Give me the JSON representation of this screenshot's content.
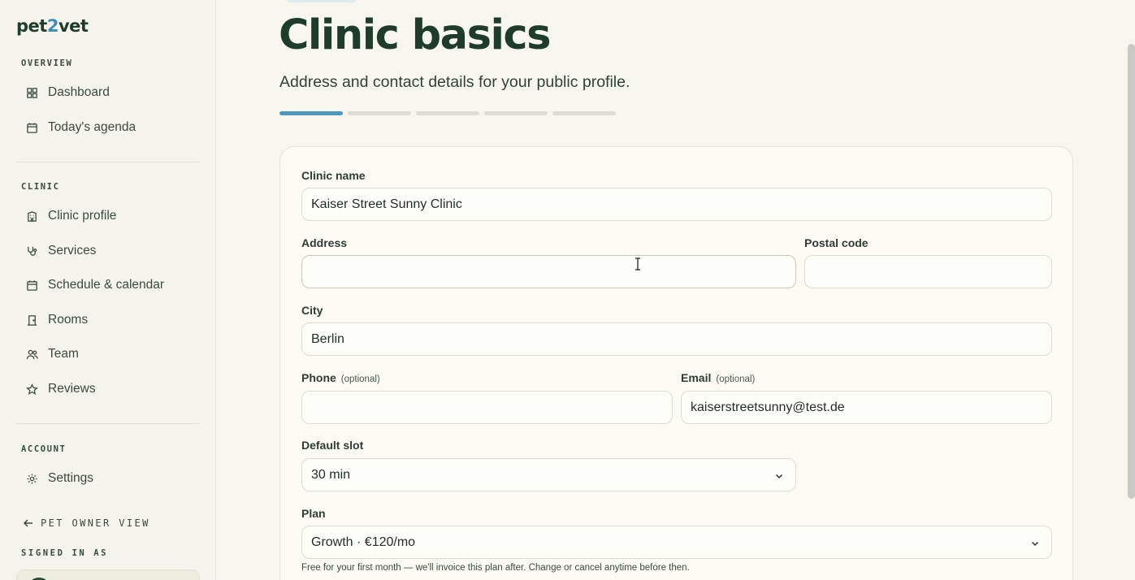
{
  "brand": {
    "prefix": "pet",
    "two": "2",
    "suffix": "vet"
  },
  "sidebar": {
    "overview_label": "OVERVIEW",
    "overview_items": [
      {
        "label": "Dashboard",
        "icon": "grid-icon"
      },
      {
        "label": "Today's agenda",
        "icon": "calendar-icon"
      }
    ],
    "clinic_label": "CLINIC",
    "clinic_items": [
      {
        "label": "Clinic profile",
        "icon": "building-icon"
      },
      {
        "label": "Services",
        "icon": "stethoscope-icon"
      },
      {
        "label": "Schedule & calendar",
        "icon": "calendar-icon"
      },
      {
        "label": "Rooms",
        "icon": "door-icon"
      },
      {
        "label": "Team",
        "icon": "users-icon"
      },
      {
        "label": "Reviews",
        "icon": "star-icon"
      }
    ],
    "account_label": "ACCOUNT",
    "account_items": [
      {
        "label": "Settings",
        "icon": "gear-icon"
      }
    ],
    "pet_owner_view": "PET OWNER VIEW",
    "signed_in_as": "SIGNED IN AS"
  },
  "main": {
    "title": "Clinic basics",
    "subtitle": "Address and contact details for your public profile.",
    "steps": {
      "total": 5,
      "current": 1
    },
    "form": {
      "clinic_name": {
        "label": "Clinic name",
        "value": "Kaiser Street Sunny Clinic"
      },
      "address": {
        "label": "Address",
        "value": ""
      },
      "postal_code": {
        "label": "Postal code",
        "value": ""
      },
      "city": {
        "label": "City",
        "value": "Berlin"
      },
      "phone": {
        "label": "Phone",
        "optional": "(optional)",
        "value": ""
      },
      "email": {
        "label": "Email",
        "optional": "(optional)",
        "value": "kaiserstreetsunny@test.de"
      },
      "default_slot": {
        "label": "Default slot",
        "value": "30 min"
      },
      "plan": {
        "label": "Plan",
        "value": "Growth · €120/mo"
      },
      "plan_help": "Free for your first month — we'll invoice this plan after. Change or cancel anytime before then."
    }
  },
  "colors": {
    "accent": "#4c96bf",
    "brand_dark": "#1f3b2b",
    "background": "#f6f6ef"
  }
}
